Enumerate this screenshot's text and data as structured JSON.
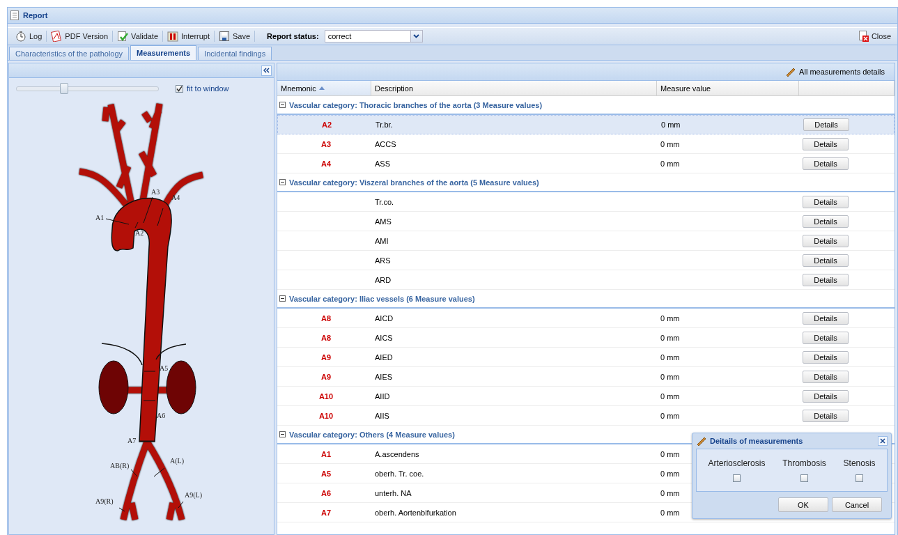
{
  "window": {
    "title": "Report"
  },
  "toolbar": {
    "buttons": [
      {
        "label": "Log",
        "kind": "log"
      },
      {
        "label": "PDF Version",
        "kind": "pdf"
      },
      {
        "label": "Validate",
        "kind": "validate"
      },
      {
        "label": "Interrupt",
        "kind": "interrupt"
      },
      {
        "label": "Save",
        "kind": "save"
      }
    ],
    "status_label": "Report status:",
    "status_value": "correct",
    "close": "Close"
  },
  "tabs": [
    {
      "label": "Characteristics of the pathology",
      "selected": false
    },
    {
      "label": "Measurements",
      "selected": true
    },
    {
      "label": "Incidental findings",
      "selected": false
    }
  ],
  "left_panel": {
    "slider": {
      "level": 0.33
    },
    "fit_to_window": {
      "label": "fit to window",
      "checked": true
    },
    "diagram_labels": [
      "A1",
      "A2",
      "A3",
      "A4",
      "A5",
      "A6",
      "A7",
      "AB(R)",
      "A(L)",
      "A9(R)",
      "A9(L)"
    ]
  },
  "right_panel": {
    "toolbar_button": "All measurements details",
    "columns": [
      {
        "label": "Mnemonic",
        "sorted": true
      },
      {
        "label": "Description",
        "sorted": false
      },
      {
        "label": "Measure value",
        "sorted": false
      }
    ],
    "groups": [
      {
        "title": "Vascular category: Thoracic branches of the aorta (3 Measure values)",
        "expanded": true,
        "rows": [
          {
            "mnemonic": "A2",
            "description": "Tr.br.",
            "value": "0 mm",
            "button": "Details",
            "selected": true
          },
          {
            "mnemonic": "A3",
            "description": "ACCS",
            "value": "0 mm",
            "button": "Details",
            "selected": false
          },
          {
            "mnemonic": "A4",
            "description": "ASS",
            "value": "0 mm",
            "button": "Details",
            "selected": false
          }
        ]
      },
      {
        "title": "Vascular category: Viszeral branches of the aorta (5 Measure values)",
        "expanded": true,
        "rows": [
          {
            "description": "Tr.co.",
            "button": "Details",
            "selected": false
          },
          {
            "description": "AMS",
            "button": "Details",
            "selected": false
          },
          {
            "description": "AMI",
            "button": "Details",
            "selected": false
          },
          {
            "description": "ARS",
            "button": "Details",
            "selected": false
          },
          {
            "description": "ARD",
            "button": "Details",
            "selected": false
          }
        ]
      },
      {
        "title": "Vascular category: Iliac vessels (6 Measure values)",
        "expanded": true,
        "rows": [
          {
            "mnemonic": "A8",
            "description": "AICD",
            "value": "0 mm",
            "button": "Details",
            "selected": false
          },
          {
            "mnemonic": "A8",
            "description": "AICS",
            "value": "0 mm",
            "button": "Details",
            "selected": false
          },
          {
            "mnemonic": "A9",
            "description": "AIED",
            "value": "0 mm",
            "button": "Details",
            "selected": false
          },
          {
            "mnemonic": "A9",
            "description": "AIES",
            "value": "0 mm",
            "button": "Details",
            "selected": false
          },
          {
            "mnemonic": "A10",
            "description": "AIID",
            "value": "0 mm",
            "button": "Details",
            "selected": false
          },
          {
            "mnemonic": "A10",
            "description": "AIIS",
            "value": "0 mm",
            "button": "Details",
            "selected": false
          }
        ]
      },
      {
        "title": "Vascular category: Others (4 Measure values)",
        "expanded": true,
        "rows": [
          {
            "mnemonic": "A1",
            "description": "A.ascendens",
            "value": "0 mm",
            "selected": false
          },
          {
            "mnemonic": "A5",
            "description": "oberh. Tr. coe.",
            "value": "0 mm",
            "selected": false
          },
          {
            "mnemonic": "A6",
            "description": "unterh. NA",
            "value": "0 mm",
            "selected": false
          },
          {
            "mnemonic": "A7",
            "description": "oberh. Aortenbifurkation",
            "value": "0 mm",
            "selected": false
          }
        ]
      }
    ]
  },
  "dialog": {
    "title": "Deitails of measurements",
    "options": [
      {
        "label": "Arteriosclerosis",
        "checked": false
      },
      {
        "label": "Thrombosis",
        "checked": false
      },
      {
        "label": "Stenosis",
        "checked": false
      }
    ],
    "buttons": [
      "OK",
      "Cancel"
    ]
  }
}
